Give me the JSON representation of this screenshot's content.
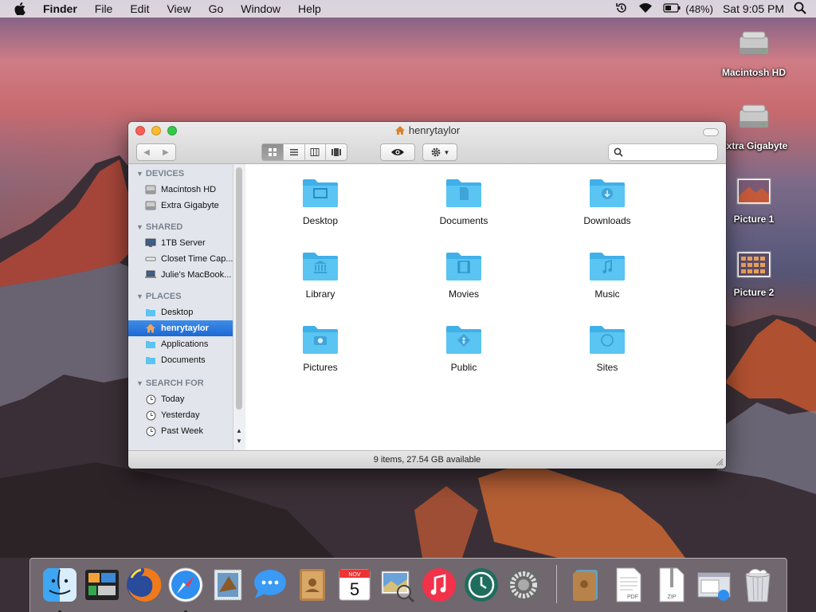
{
  "menubar": {
    "app": "Finder",
    "items": [
      "File",
      "Edit",
      "View",
      "Go",
      "Window",
      "Help"
    ],
    "battery": "(48%)",
    "clock": "Sat 9:05 PM"
  },
  "desktop_icons": [
    {
      "label": "Macintosh HD"
    },
    {
      "label": "Extra Gigabyte"
    },
    {
      "label": "Picture 1"
    },
    {
      "label": "Picture 2"
    }
  ],
  "window": {
    "title": "henrytaylor",
    "search_placeholder": "",
    "status": "9 items, 27.54 GB available"
  },
  "sidebar": {
    "sections": [
      {
        "header": "DEVICES",
        "items": [
          "Macintosh HD",
          "Extra Gigabyte"
        ]
      },
      {
        "header": "SHARED",
        "items": [
          "1TB Server",
          "Closet Time Cap...",
          "Julie's MacBook..."
        ]
      },
      {
        "header": "PLACES",
        "items": [
          "Desktop",
          "henrytaylor",
          "Applications",
          "Documents"
        ]
      },
      {
        "header": "SEARCH FOR",
        "items": [
          "Today",
          "Yesterday",
          "Past Week"
        ]
      }
    ]
  },
  "folders": [
    {
      "label": "Desktop",
      "glyph": "desktop-icon"
    },
    {
      "label": "Documents",
      "glyph": "document-icon"
    },
    {
      "label": "Downloads",
      "glyph": "download-icon"
    },
    {
      "label": "Library",
      "glyph": "library-icon"
    },
    {
      "label": "Movies",
      "glyph": "film-icon"
    },
    {
      "label": "Music",
      "glyph": "music-note-icon"
    },
    {
      "label": "Pictures",
      "glyph": "camera-icon"
    },
    {
      "label": "Public",
      "glyph": "public-icon"
    },
    {
      "label": "Sites",
      "glyph": "compass-icon"
    }
  ],
  "dock": {
    "calendar_month": "NOV",
    "calendar_day": "5",
    "pdf_label": "PDF",
    "zip_label": "ZIP"
  },
  "colors": {
    "selection": "#1c69d3",
    "folder": "#5ac4f2"
  }
}
